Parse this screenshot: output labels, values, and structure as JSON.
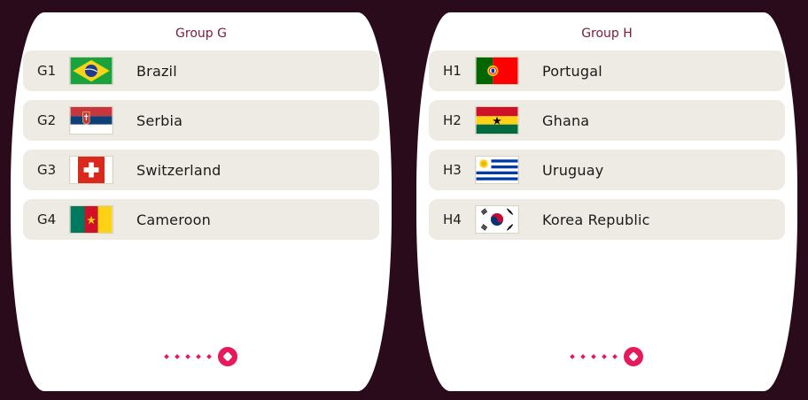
{
  "colors": {
    "background": "#2a0b1c",
    "row_bg": "#edebe3",
    "accent": "#e6195a",
    "title": "#7a1a3a"
  },
  "group_g": {
    "title": "Group G",
    "teams": [
      {
        "code": "G1",
        "name": "Brazil",
        "flag_icon": "brazil-flag-icon"
      },
      {
        "code": "G2",
        "name": "Serbia",
        "flag_icon": "serbia-flag-icon"
      },
      {
        "code": "G3",
        "name": "Switzerland",
        "flag_icon": "switzerland-flag-icon"
      },
      {
        "code": "G4",
        "name": "Cameroon",
        "flag_icon": "cameroon-flag-icon"
      }
    ],
    "pager_icon": "football-icon"
  },
  "group_h": {
    "title": "Group H",
    "teams": [
      {
        "code": "H1",
        "name": "Portugal",
        "flag_icon": "portugal-flag-icon"
      },
      {
        "code": "H2",
        "name": "Ghana",
        "flag_icon": "ghana-flag-icon"
      },
      {
        "code": "H3",
        "name": "Uruguay",
        "flag_icon": "uruguay-flag-icon"
      },
      {
        "code": "H4",
        "name": "Korea Republic",
        "flag_icon": "korea-republic-flag-icon"
      }
    ],
    "pager_icon": "football-icon"
  }
}
